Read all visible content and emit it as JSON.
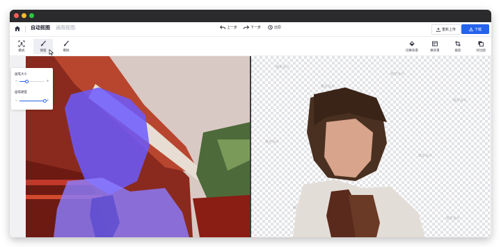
{
  "header": {
    "tabs": [
      {
        "label": "自动抠图",
        "active": true
      },
      {
        "label": "通用抠图",
        "active": false
      }
    ],
    "history": {
      "undo": "上一步",
      "redo": "下一步",
      "reset": "还原"
    },
    "reupload": "重新上传",
    "download": "下载"
  },
  "toolbar": {
    "left": [
      {
        "icon": "mode-icon",
        "label": "模式"
      },
      {
        "icon": "brush-keep-icon",
        "label": "保留",
        "active": true
      },
      {
        "icon": "brush-erase-icon",
        "label": "擦除"
      }
    ],
    "right": [
      {
        "icon": "fill-bucket-icon",
        "label": "切换背景"
      },
      {
        "icon": "layout-icon",
        "label": "换背景"
      },
      {
        "icon": "crop-icon",
        "label": "裁剪"
      },
      {
        "icon": "layers-icon",
        "label": "对比图"
      }
    ]
  },
  "brush_panel": {
    "size_label": "画笔大小",
    "size_value": 0.3,
    "hardness_label": "画笔硬度",
    "hardness_value": 1.0
  },
  "watermark": "稿定设计",
  "colors": {
    "accent": "#2563eb",
    "selection_overlay": "#6b5bff"
  }
}
